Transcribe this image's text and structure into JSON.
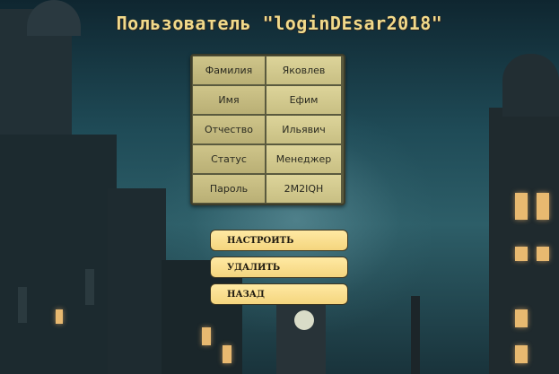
{
  "title": "Пользователь \"loginDEsar2018\"",
  "fields": [
    {
      "label": "Фамилия",
      "value": "Яковлев"
    },
    {
      "label": "Имя",
      "value": "Ефим"
    },
    {
      "label": "Отчество",
      "value": "Ильявич"
    },
    {
      "label": "Статус",
      "value": "Менеджер"
    },
    {
      "label": "Пароль",
      "value": "2M2IQH"
    }
  ],
  "buttons": {
    "configure": "НАСТРОИТЬ",
    "delete": "УДАЛИТЬ",
    "back": "НАЗАД"
  },
  "colors": {
    "title": "#f1d98a",
    "button": "#f4d57e",
    "cell": "#c8bf83"
  }
}
